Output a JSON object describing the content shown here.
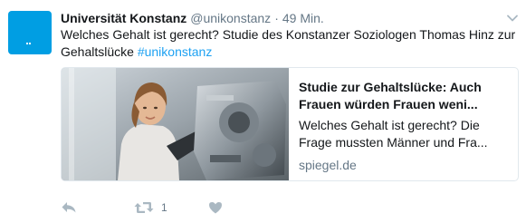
{
  "tweet": {
    "author_name": "Universität Konstanz",
    "author_handle": "@unikonstanz",
    "separator": "·",
    "time": "49 Min.",
    "text": "Welches Gehalt ist gerecht? Studie des Konstanzer Soziologen Thomas Hinz zur Gehaltslücke",
    "hashtag": "#unikonstanz"
  },
  "card": {
    "title": "Studie zur Gehaltslücke: Auch Frauen würden Frauen weni...",
    "description": "Welches Gehalt ist gerecht? Die Frage mussten Männer und Fra...",
    "domain": "spiegel.de"
  },
  "actions": {
    "retweet_count": "1"
  },
  "colors": {
    "avatar": "#009ee3",
    "text": "#14171a",
    "muted": "#657786",
    "hashtag": "#1da1f2",
    "icon": "#aab8c2",
    "card_border": "#e1e8ed"
  },
  "icons": {
    "more": "chevron-down-icon",
    "reply": "reply-icon",
    "retweet": "retweet-icon",
    "like": "heart-icon"
  }
}
